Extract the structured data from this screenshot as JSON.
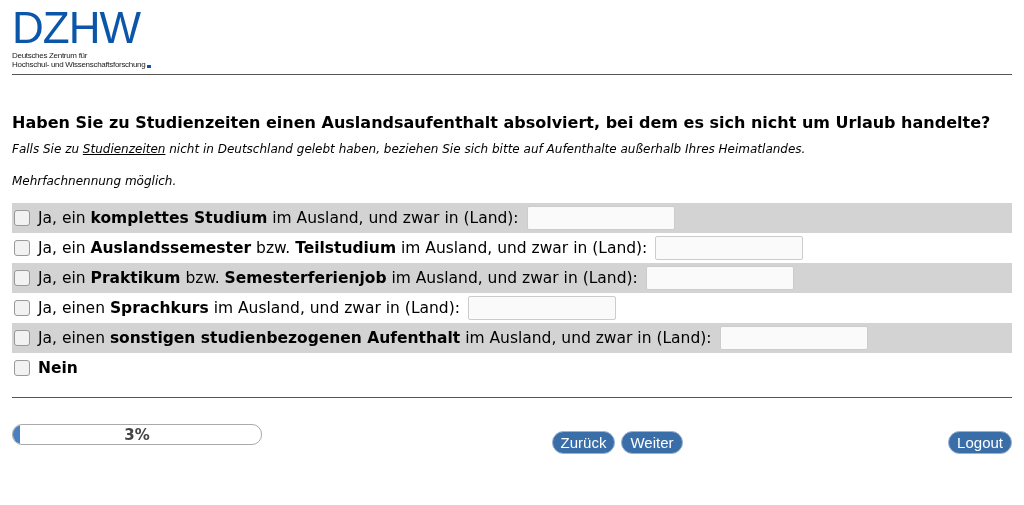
{
  "logo": {
    "text": "DZHW",
    "subtitle": [
      "Deutsches Zentrum für",
      "Hochschul- und Wissenschaftsforschung"
    ]
  },
  "question": {
    "title": "Haben Sie zu Studienzeiten einen Auslandsaufenthalt absolviert, bei dem es sich nicht um Urlaub handelte?",
    "hint_before": "Falls Sie zu",
    "hint_link": "Studienzeiten",
    "hint_after": "nicht in Deutschland gelebt haben, beziehen Sie sich bitte auf Aufenthalte außerhalb Ihres Heimatlandes.",
    "note": "Mehrfachnennung möglich."
  },
  "options": [
    {
      "kind": "text_entry",
      "label": "Ja, ein **komplettes Studium** im Ausland, und zwar in (Land):",
      "checked": false
    },
    {
      "kind": "text_entry",
      "label": "Ja, ein **Auslandssemester** bzw. **Teilstudium** im Ausland, und zwar in (Land):",
      "checked": false
    },
    {
      "kind": "text_entry",
      "label": "Ja, ein **Praktikum** bzw. **Semesterferienjob** im Ausland, und zwar in (Land):",
      "checked": false
    },
    {
      "kind": "text_entry",
      "label": "Ja, einen **Sprachkurs** im Ausland, und zwar in (Land):",
      "checked": false
    },
    {
      "kind": "text_entry",
      "label": "Ja, einen **sonstigen studienbezogenen Aufenthalt** im Ausland, und zwar in (Land):",
      "checked": false
    },
    {
      "kind": "exclusive",
      "label": "Nein",
      "checked": false
    }
  ],
  "progress": {
    "level": 0.03,
    "text": "3%"
  },
  "nav_buttons": [
    "Zurück",
    "Weiter"
  ],
  "logout": "Logout"
}
